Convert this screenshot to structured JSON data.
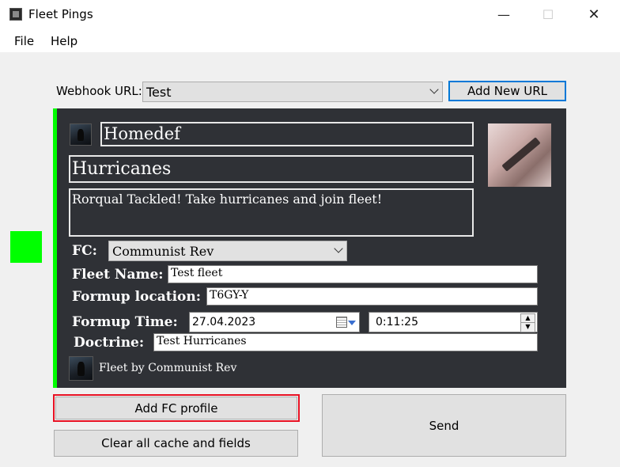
{
  "window": {
    "title": "Fleet Pings"
  },
  "menu": [
    "File",
    "Help"
  ],
  "webhook": {
    "label": "Webhook URL:",
    "selected": "Test",
    "add_button": "Add New URL"
  },
  "embed": {
    "accent_color": "#00ff00",
    "author": "Homedef",
    "title": "Hurricanes",
    "description": "Rorqual Tackled! Take hurricanes and join fleet!",
    "fc_label": "FC:",
    "fc_value": "Communist Rev",
    "fleet_name_label": "Fleet Name:",
    "fleet_name_value": "Test fleet",
    "formup_location_label": "Formup location:",
    "formup_location_value": "T6GY-Y",
    "formup_time_label": "Formup Time:",
    "formup_date": "27.04.2023",
    "formup_time": "0:11:25",
    "doctrine_label": "Doctrine:",
    "doctrine_value": "Test Hurricanes",
    "footer": "Fleet by Communist Rev"
  },
  "buttons": {
    "add_fc": "Add FC profile",
    "clear": "Clear all cache and fields",
    "send": "Send"
  }
}
